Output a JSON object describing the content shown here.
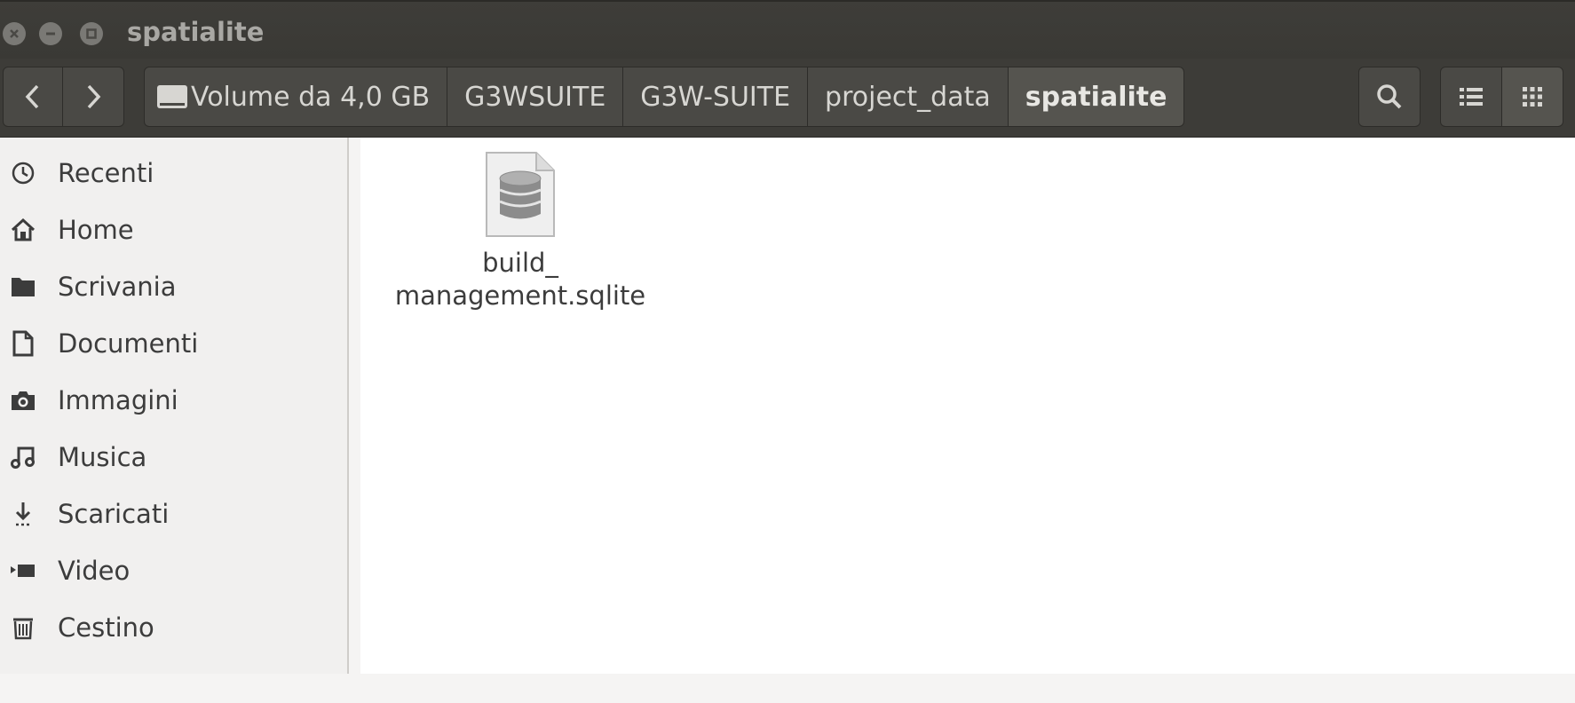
{
  "window": {
    "title": "spatialite"
  },
  "toolbar": {
    "back_icon": "chevron-left",
    "forward_icon": "chevron-right",
    "breadcrumbs": [
      {
        "label": "Volume da 4,0 GB",
        "icon": "drive-icon"
      },
      {
        "label": "G3WSUITE"
      },
      {
        "label": "G3W-SUITE"
      },
      {
        "label": "project_data"
      },
      {
        "label": "spatialite"
      }
    ],
    "search_icon": "search-icon",
    "list_view_icon": "list-icon",
    "grid_view_icon": "grid-icon"
  },
  "sidebar": {
    "items": [
      {
        "label": "Recenti",
        "icon": "clock-icon"
      },
      {
        "label": "Home",
        "icon": "home-icon"
      },
      {
        "label": "Scrivania",
        "icon": "folder-icon"
      },
      {
        "label": "Documenti",
        "icon": "document-icon"
      },
      {
        "label": "Immagini",
        "icon": "camera-icon"
      },
      {
        "label": "Musica",
        "icon": "music-icon"
      },
      {
        "label": "Scaricati",
        "icon": "download-icon"
      },
      {
        "label": "Video",
        "icon": "video-icon"
      },
      {
        "label": "Cestino",
        "icon": "trash-icon"
      }
    ]
  },
  "content": {
    "files": [
      {
        "name": "build_\nmanagement.sqlite",
        "icon": "database-file-icon"
      }
    ]
  },
  "colors": {
    "titlebar": "#3e3d39",
    "toolbar": "#3d3c38",
    "sidebar": "#f1f0ef",
    "content": "#ffffff"
  }
}
